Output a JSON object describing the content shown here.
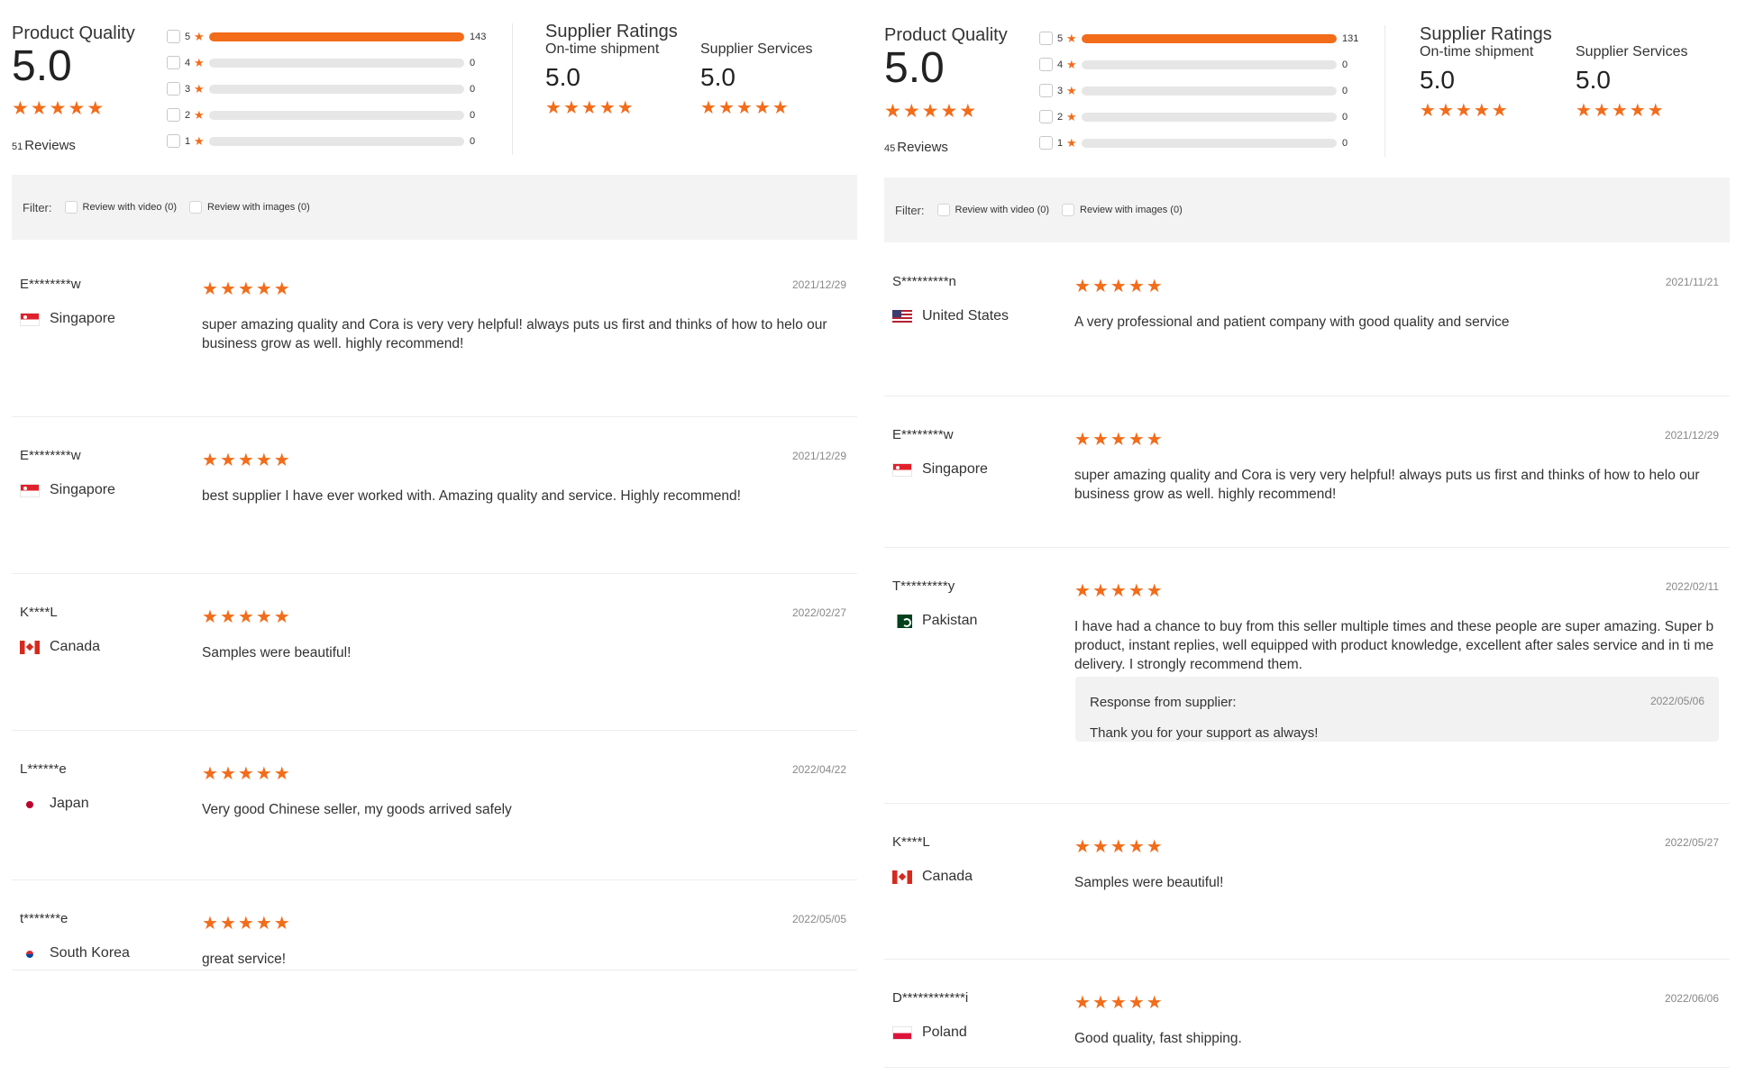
{
  "star_glyph": "★",
  "accent_color": "#f26c1a",
  "left": {
    "summary": {
      "product_quality_title": "Product Quality",
      "score": "5.0",
      "reviews_count": "51",
      "reviews_label": "Reviews",
      "breakdown": [
        {
          "stars": "5",
          "count": "143",
          "fill_fraction": 1.0
        },
        {
          "stars": "4",
          "count": "0",
          "fill_fraction": 0
        },
        {
          "stars": "3",
          "count": "0",
          "fill_fraction": 0
        },
        {
          "stars": "2",
          "count": "0",
          "fill_fraction": 0
        },
        {
          "stars": "1",
          "count": "0",
          "fill_fraction": 0
        }
      ],
      "supplier_ratings_title": "Supplier Ratings",
      "ontime_label": "On-time shipment",
      "ontime_score": "5.0",
      "services_label": "Supplier Services",
      "services_score": "5.0"
    },
    "filter": {
      "label": "Filter:",
      "video": "Review with video (0)",
      "images": "Review with images (0)"
    },
    "reviews": [
      {
        "name": "E********w",
        "country": "Singapore",
        "flag": "sg",
        "date": "2021/12/29",
        "text": "super amazing quality and Cora is very very helpful! always puts us first and thinks of how to helo our business grow as well. highly recommend!",
        "rating": 5
      },
      {
        "name": "E********w",
        "country": "Singapore",
        "flag": "sg",
        "date": "2021/12/29",
        "text": "best supplier I have ever worked with. Amazing quality and service. Highly recommend!",
        "rating": 5
      },
      {
        "name": "K****L",
        "country": "Canada",
        "flag": "ca",
        "date": "2022/02/27",
        "text": "Samples were beautiful!",
        "rating": 5
      },
      {
        "name": "L******e",
        "country": "Japan",
        "flag": "jp",
        "date": "2022/04/22",
        "text": "Very good Chinese seller, my goods arrived safely",
        "rating": 5
      },
      {
        "name": "t*******e",
        "country": "South Korea",
        "flag": "kr",
        "date": "2022/05/05",
        "text": "great service!",
        "rating": 5
      }
    ]
  },
  "right": {
    "summary": {
      "product_quality_title": "Product Quality",
      "score": "5.0",
      "reviews_count": "45",
      "reviews_label": "Reviews",
      "breakdown": [
        {
          "stars": "5",
          "count": "131",
          "fill_fraction": 1.0
        },
        {
          "stars": "4",
          "count": "0",
          "fill_fraction": 0
        },
        {
          "stars": "3",
          "count": "0",
          "fill_fraction": 0
        },
        {
          "stars": "2",
          "count": "0",
          "fill_fraction": 0
        },
        {
          "stars": "1",
          "count": "0",
          "fill_fraction": 0
        }
      ],
      "supplier_ratings_title": "Supplier Ratings",
      "ontime_label": "On-time shipment",
      "ontime_score": "5.0",
      "services_label": "Supplier Services",
      "services_score": "5.0"
    },
    "filter": {
      "label": "Filter:",
      "video": "Review with video (0)",
      "images": "Review with images (0)"
    },
    "reviews": [
      {
        "name": "S*********n",
        "country": "United States",
        "flag": "us",
        "date": "2021/11/21",
        "text": "A very professional and patient company with good quality and service",
        "rating": 5
      },
      {
        "name": "E********w",
        "country": "Singapore",
        "flag": "sg",
        "date": "2021/12/29",
        "text": "super amazing quality and Cora is very very helpful! always puts us first and thinks of how to helo our business grow as well. highly recommend!",
        "rating": 5
      },
      {
        "name": "T*********y",
        "country": "Pakistan",
        "flag": "pk",
        "date": "2022/02/11",
        "text": "I have had a chance to buy from this seller multiple times and these people are super amazing. Super b product, instant replies, well equipped with product knowledge, excellent after sales service and in ti me delivery. I strongly recommend them.",
        "rating": 5,
        "response": {
          "label": "Response from supplier:",
          "date": "2022/05/06",
          "text": "Thank you for your support as always!"
        }
      },
      {
        "name": "K****L",
        "country": "Canada",
        "flag": "ca",
        "date": "2022/05/27",
        "text": "Samples were beautiful!",
        "rating": 5
      },
      {
        "name": "D************i",
        "country": "Poland",
        "flag": "pl",
        "date": "2022/06/06",
        "text": "Good quality, fast shipping.",
        "rating": 5
      }
    ]
  }
}
